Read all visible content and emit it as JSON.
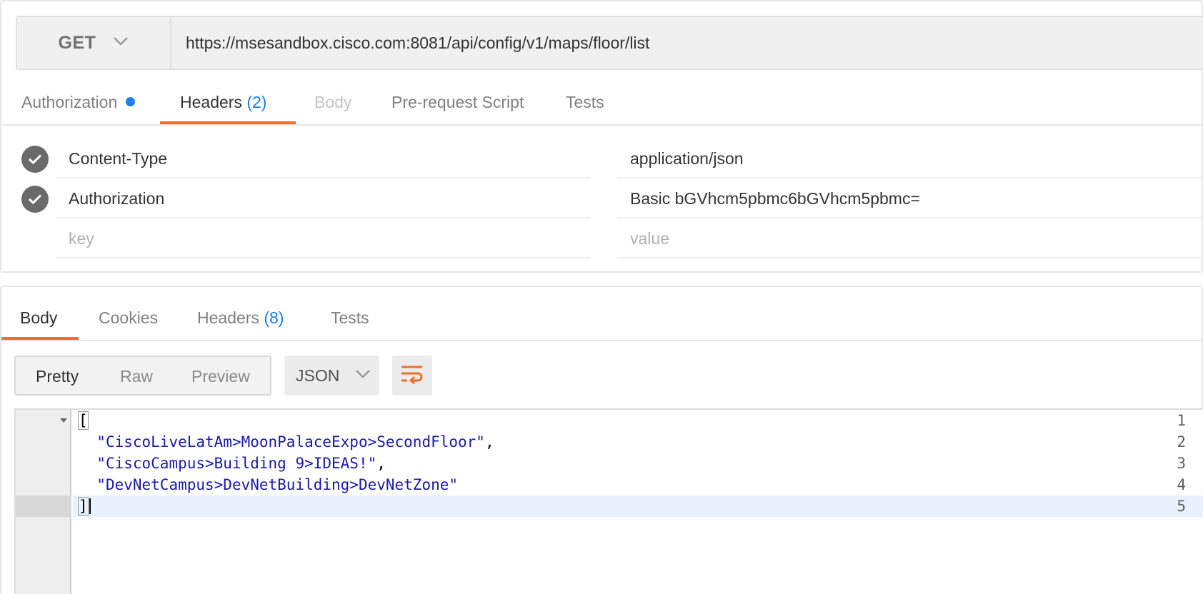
{
  "request": {
    "method": "GET",
    "url": "https://msesandbox.cisco.com:8081/api/config/v1/maps/floor/list",
    "tabs": [
      {
        "label": "Authorization",
        "state": "muted",
        "indicator": true
      },
      {
        "label": "Headers",
        "count": "(2)",
        "state": "active"
      },
      {
        "label": "Body",
        "state": "disabled"
      },
      {
        "label": "Pre-request Script",
        "state": "muted"
      },
      {
        "label": "Tests",
        "state": "muted"
      }
    ],
    "headers": [
      {
        "enabled": true,
        "key": "Content-Type",
        "value": "application/json"
      },
      {
        "enabled": true,
        "key": "Authorization",
        "value": "Basic bGVhcm5pbmc6bGVhcm5pbmc="
      }
    ],
    "new_row": {
      "key_placeholder": "key",
      "value_placeholder": "value"
    }
  },
  "response": {
    "tabs": [
      {
        "label": "Body",
        "state": "active"
      },
      {
        "label": "Cookies",
        "state": "muted"
      },
      {
        "label": "Headers",
        "count": "(8)",
        "state": "muted"
      },
      {
        "label": "Tests",
        "state": "muted"
      }
    ],
    "view_modes": [
      "Pretty",
      "Raw",
      "Preview"
    ],
    "selected_view": "Pretty",
    "format": "JSON",
    "lines": [
      {
        "num": "1",
        "text": "["
      },
      {
        "num": "2",
        "text": "\"CiscoLiveLatAm>MoonPalaceExpo>SecondFloor\"",
        "suffix": ","
      },
      {
        "num": "3",
        "text": "\"CiscoCampus>Building 9>IDEAS!\"",
        "suffix": ","
      },
      {
        "num": "4",
        "text": "\"DevNetCampus>DevNetBuilding>DevNetZone\"",
        "suffix": ""
      },
      {
        "num": "5",
        "text": "]"
      }
    ]
  },
  "colors": {
    "accent": "#f26b2b",
    "link": "#1a7fe0",
    "string": "#1a1aa6",
    "active_line": "#e8f1fc"
  }
}
